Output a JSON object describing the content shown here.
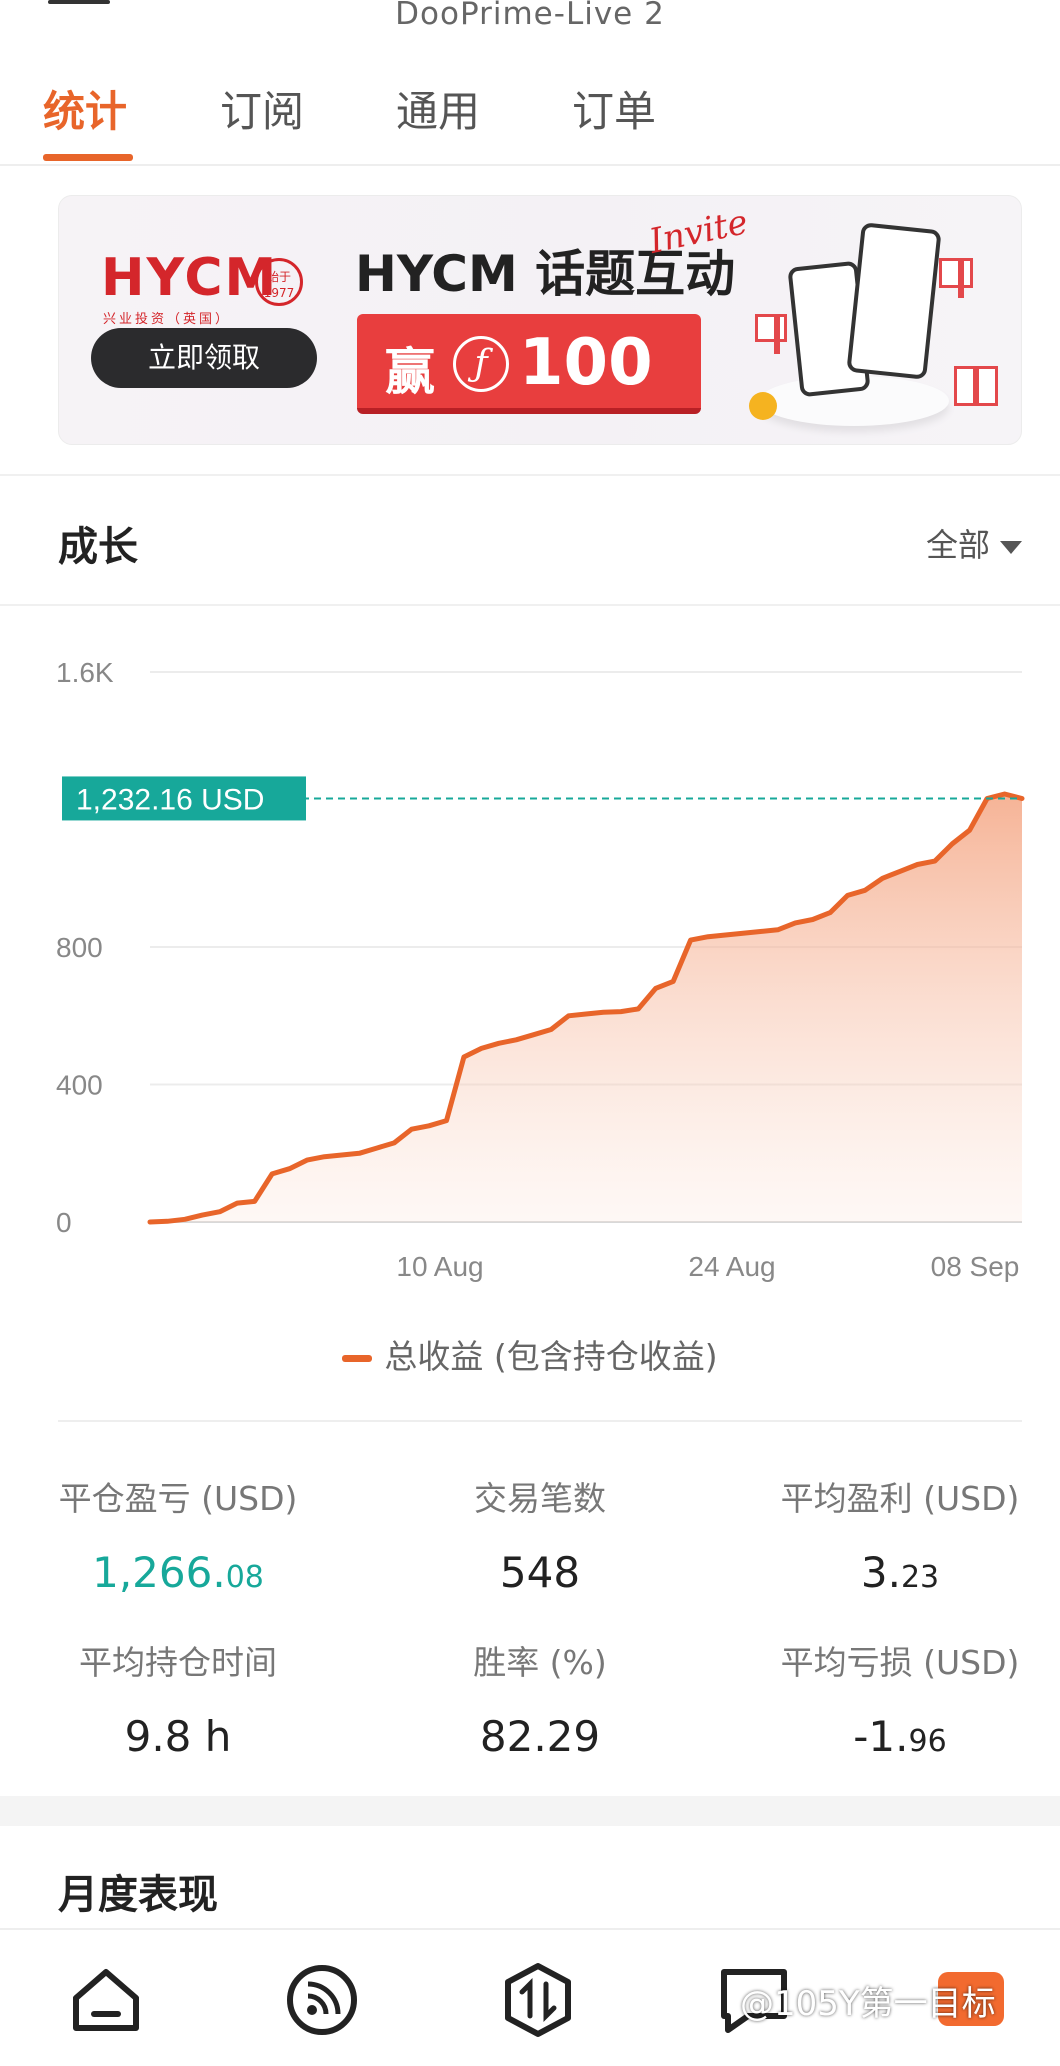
{
  "window": {
    "title": "DooPrime-Live 2"
  },
  "tabs": [
    {
      "label": "统计",
      "active": true
    },
    {
      "label": "订阅",
      "active": false
    },
    {
      "label": "通用",
      "active": false
    },
    {
      "label": "订单",
      "active": false
    }
  ],
  "banner": {
    "logo": "HYCM",
    "logo_sub": "兴业投资（英国）",
    "seal_text": "始于 1977",
    "cta": "立即领取",
    "headline": "HYCM 话题互动",
    "headline_script": "Invite",
    "prize_prefix": "赢",
    "prize_currency_symbol": "ƒ",
    "prize_amount": "100"
  },
  "growth": {
    "title": "成长",
    "range": "全部"
  },
  "chart_data": {
    "type": "area",
    "y_ticks": [
      "0",
      "400",
      "800",
      "1.6K"
    ],
    "ylim": [
      0,
      1600
    ],
    "x_ticks": [
      "10 Aug",
      "24 Aug",
      "08 Sep"
    ],
    "current_value_label": "1,232.16 USD",
    "current_value": 1232.16,
    "series": [
      {
        "name": "总收益 (包含持仓收益)",
        "color": "#e8652a",
        "x": [
          "2024-07-22",
          "2024-07-23",
          "2024-07-24",
          "2024-07-25",
          "2024-07-26",
          "2024-07-27",
          "2024-07-28",
          "2024-07-29",
          "2024-07-30",
          "2024-07-31",
          "2024-08-01",
          "2024-08-02",
          "2024-08-03",
          "2024-08-04",
          "2024-08-05",
          "2024-08-06",
          "2024-08-07",
          "2024-08-08",
          "2024-08-09",
          "2024-08-10",
          "2024-08-11",
          "2024-08-12",
          "2024-08-13",
          "2024-08-14",
          "2024-08-15",
          "2024-08-16",
          "2024-08-17",
          "2024-08-18",
          "2024-08-19",
          "2024-08-20",
          "2024-08-21",
          "2024-08-22",
          "2024-08-23",
          "2024-08-24",
          "2024-08-25",
          "2024-08-26",
          "2024-08-27",
          "2024-08-28",
          "2024-08-29",
          "2024-08-30",
          "2024-08-31",
          "2024-09-01",
          "2024-09-02",
          "2024-09-03",
          "2024-09-04",
          "2024-09-05",
          "2024-09-06",
          "2024-09-07",
          "2024-09-08",
          "2024-09-09",
          "2024-09-10"
        ],
        "values": [
          0,
          2,
          8,
          20,
          30,
          55,
          60,
          140,
          155,
          180,
          190,
          195,
          200,
          215,
          230,
          270,
          280,
          295,
          480,
          505,
          520,
          530,
          545,
          560,
          600,
          605,
          610,
          612,
          620,
          680,
          700,
          820,
          830,
          835,
          840,
          845,
          850,
          870,
          880,
          900,
          950,
          965,
          1000,
          1020,
          1040,
          1050,
          1100,
          1140,
          1232,
          1245,
          1232
        ]
      }
    ]
  },
  "legend": {
    "label": "总收益 (包含持仓收益)"
  },
  "stats": [
    {
      "label": "平仓盈亏 (USD)",
      "value_main": "1,266.",
      "value_small": "08",
      "color": "#17a89a"
    },
    {
      "label": "交易笔数",
      "value_main": "548",
      "value_small": "",
      "color": "#222222"
    },
    {
      "label": "平均盈利 (USD)",
      "value_main": "3.",
      "value_small": "23",
      "color": "#222222"
    },
    {
      "label": "平均持仓时间",
      "value_main": "9.8 h",
      "value_small": "",
      "color": "#222222"
    },
    {
      "label": "胜率 (%)",
      "value_main": "82.29",
      "value_small": "",
      "color": "#222222"
    },
    {
      "label": "平均亏损 (USD)",
      "value_main": "-1.",
      "value_small": "96",
      "color": "#222222"
    }
  ],
  "monthly": {
    "title": "月度表现"
  },
  "bottom_nav": [
    {
      "icon": "home-icon"
    },
    {
      "icon": "feed-icon"
    },
    {
      "icon": "trade-icon"
    },
    {
      "icon": "chat-icon"
    },
    {
      "icon": "profile-icon"
    }
  ],
  "watermark": "@105Y第一目标",
  "colors": {
    "accent": "#e8652a",
    "positive": "#17a89a",
    "reference_line": "#17a89a"
  }
}
